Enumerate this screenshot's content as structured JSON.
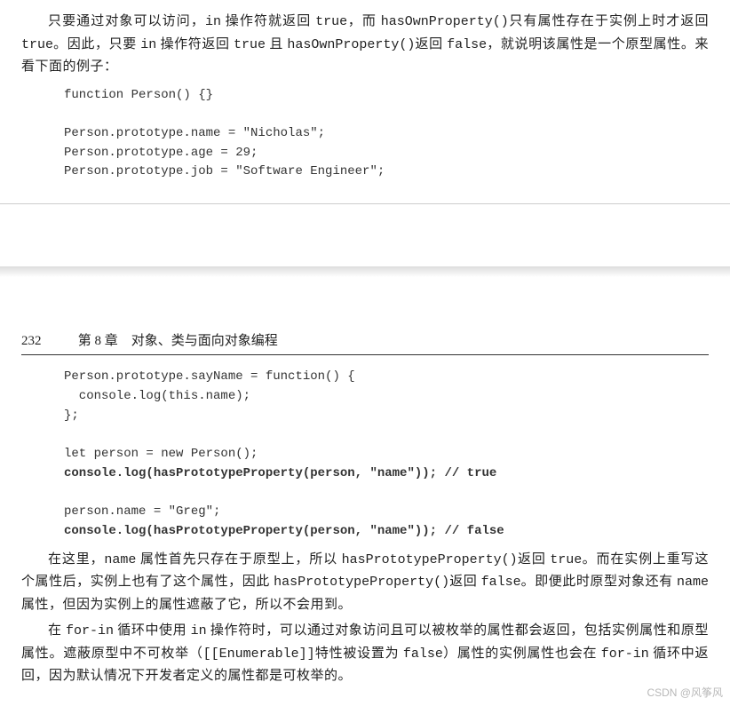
{
  "top": {
    "para1_seg1": "只要通过对象可以访问，",
    "para1_in": "in",
    "para1_seg2": " 操作符就返回 ",
    "para1_true1": "true",
    "para1_seg3": "，而 ",
    "para1_hop": "hasOwnProperty()",
    "para1_seg4": "只有属性存在于实例上时才返回 ",
    "para1_true2": "true",
    "para1_seg5": "。因此，只要 ",
    "para1_in2": "in",
    "para1_seg6": " 操作符返回 ",
    "para1_true3": "true",
    "para1_seg7": " 且 ",
    "para1_hop2": "hasOwnProperty()",
    "para1_seg8": "返回 ",
    "para1_false": "false",
    "para1_seg9": "，就说明该属性是一个原型属性。来看下面的例子：",
    "code": "function Person() {}\n\nPerson.prototype.name = \"Nicholas\";\nPerson.prototype.age = 29;\nPerson.prototype.job = \"Software Engineer\";"
  },
  "header": {
    "page_num": "232",
    "chapter": "第 8 章　对象、类与面向对象编程"
  },
  "bottom": {
    "code1": "Person.prototype.sayName = function() {\n  console.log(this.name);\n};\n\nlet person = new Person();",
    "code1b": "console.log(hasPrototypeProperty(person, \"name\")); // true",
    "code2": "person.name = \"Greg\";",
    "code2b": "console.log(hasPrototypeProperty(person, \"name\")); // false",
    "p1_s1": "在这里，",
    "p1_name": "name",
    "p1_s2": " 属性首先只存在于原型上，所以 ",
    "p1_hpp1": "hasPrototypeProperty()",
    "p1_s3": "返回 ",
    "p1_true": "true",
    "p1_s4": "。而在实例上重写这个属性后，实例上也有了这个属性，因此 ",
    "p1_hpp2": "hasPrototypeProperty()",
    "p1_s5": "返回 ",
    "p1_false": "false",
    "p1_s6": "。即便此时原型对象还有 ",
    "p1_name2": "name",
    "p1_s7": " 属性，但因为实例上的属性遮蔽了它，所以不会用到。",
    "p2_s1": "在 ",
    "p2_forin1": "for-in",
    "p2_s2": " 循环中使用 ",
    "p2_in": "in",
    "p2_s3": " 操作符时，可以通过对象访问且可以被枚举的属性都会返回，包括实例属性和原型属性。遮蔽原型中不可枚举（",
    "p2_enum": "[[Enumerable]]",
    "p2_s4": "特性被设置为 ",
    "p2_false": "false",
    "p2_s5": "）属性的实例属性也会在 ",
    "p2_forin2": "for-in",
    "p2_s6": " 循环中返回，因为默认情况下开发者定义的属性都是可枚举的。"
  },
  "watermark": "CSDN @风筝风"
}
